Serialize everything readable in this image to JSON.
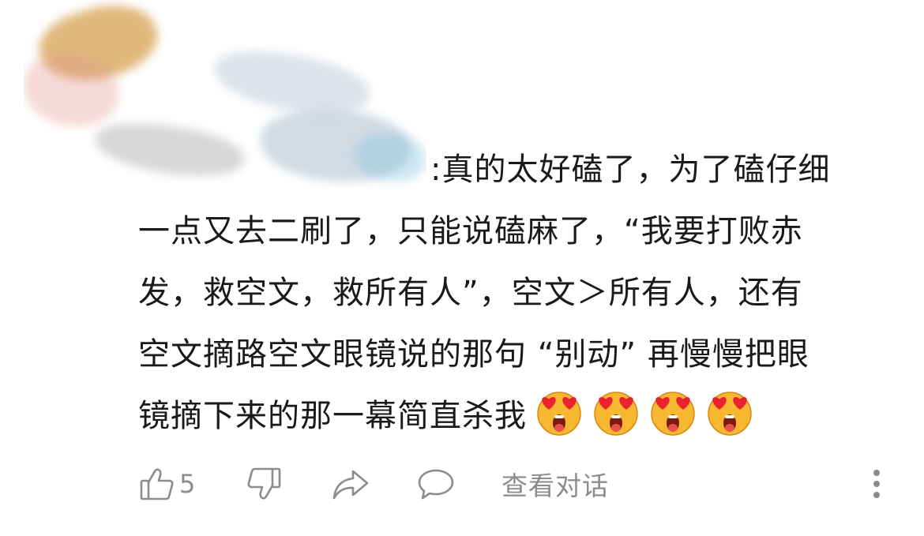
{
  "comment": {
    "author": "",
    "line1": ":真的太好磕了，为了磕仔细",
    "line2": "一点又去二刷了，只能说磕麻了，“我要打败赤",
    "line3": "发，救空文，救所有人”，空文＞所有人，还有",
    "line4": "空文摘路空文眼镜说的那句 “别动” 再慢慢把眼",
    "line5": "镜摘下来的那一幕简直杀我",
    "emojis": [
      "heart-eyes-emoji",
      "heart-eyes-emoji",
      "heart-eyes-emoji",
      "heart-eyes-emoji"
    ]
  },
  "actions": {
    "like_count": "5",
    "view_conversation": "查看对话"
  },
  "colors": {
    "text": "#1a1a1a",
    "icon": "#8c8c8c",
    "emoji_face": "#f7b731",
    "emoji_heart": "#e8232d"
  }
}
